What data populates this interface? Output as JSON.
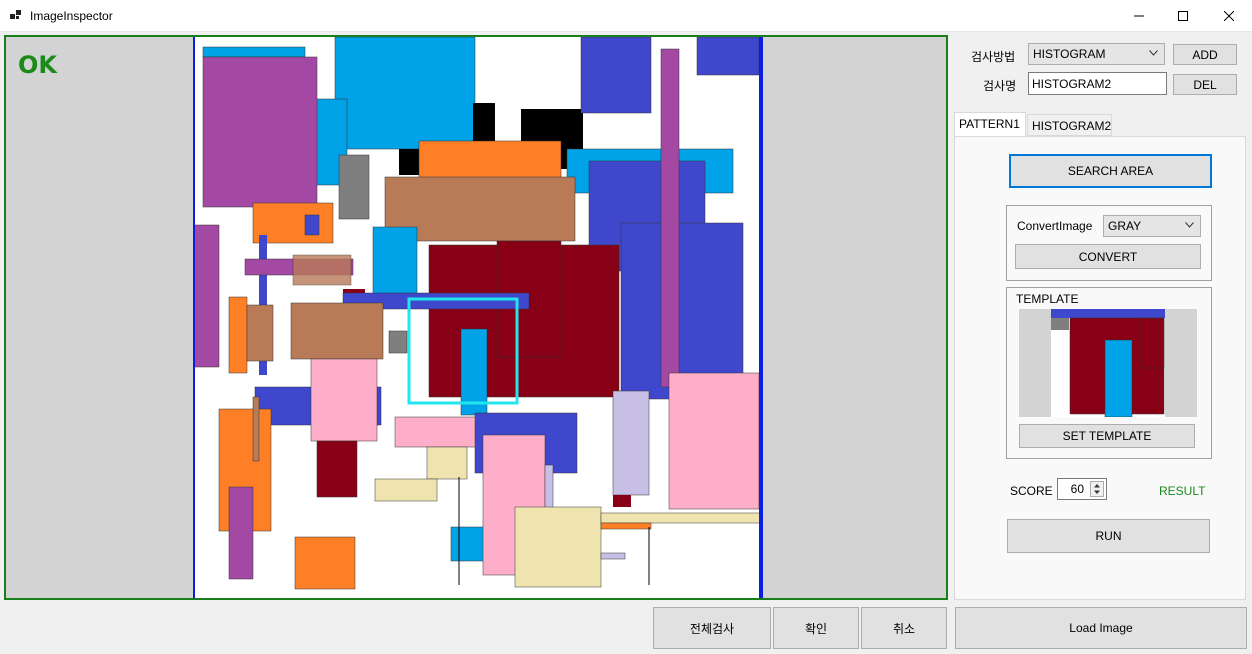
{
  "window": {
    "title": "ImageInspector",
    "minimize_icon": "minimize-icon",
    "maximize_icon": "maximize-icon",
    "close_icon": "close-icon"
  },
  "viewer": {
    "status": "OK",
    "status_color": "#1a8a1a",
    "border_color": "#1a7f1a"
  },
  "inspection": {
    "method_label": "검사방법",
    "method_value": "HISTOGRAM",
    "name_label": "검사명",
    "name_value": "HISTOGRAM2",
    "add_label": "ADD",
    "del_label": "DEL"
  },
  "tabs": [
    {
      "label": "PATTERN1",
      "active": true
    },
    {
      "label": "HISTOGRAM2",
      "active": false
    }
  ],
  "pattern": {
    "search_area_label": "SEARCH AREA",
    "convert_image_label": "ConvertImage",
    "convert_image_value": "GRAY",
    "convert_label": "CONVERT",
    "template_group_label": "TEMPLATE",
    "set_template_label": "SET TEMPLATE",
    "score_label": "SCORE",
    "score_value": "60",
    "result_label": "RESULT",
    "result_color": "#1a8a1a",
    "run_label": "RUN"
  },
  "footer": {
    "full_inspect_label": "전체검사",
    "confirm_label": "확인",
    "cancel_label": "취소",
    "load_image_label": "Load Image"
  }
}
